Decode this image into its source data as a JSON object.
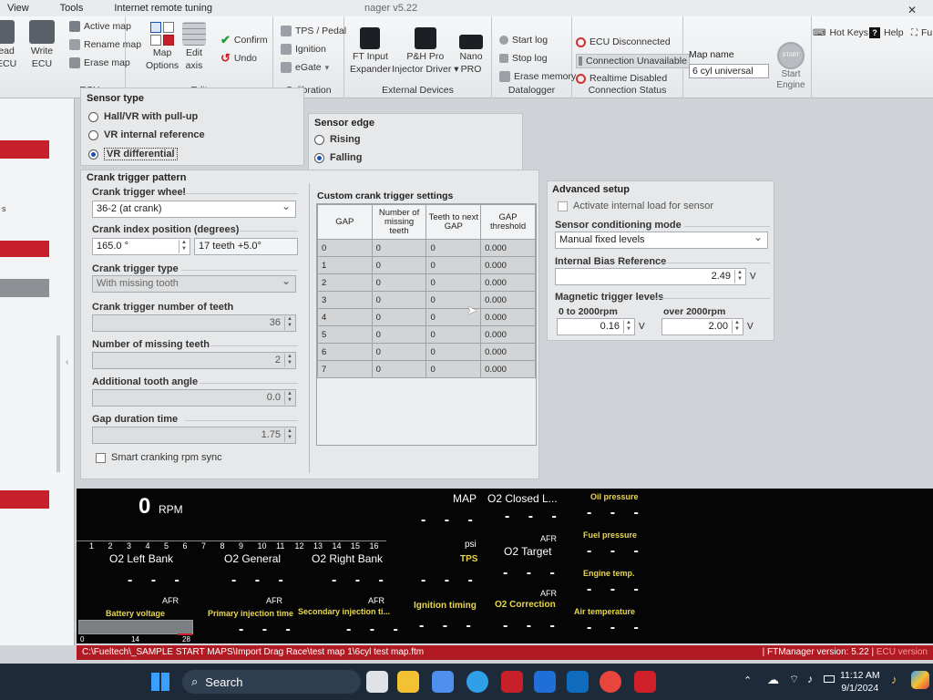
{
  "menu": [
    "View",
    "Tools",
    "Internet remote tuning"
  ],
  "window_title_partial": "nager v5.22",
  "ribbon": {
    "left_partial": {
      "read": "ead",
      "ecu": "ECU"
    },
    "write_ecu": [
      "Write",
      "ECU"
    ],
    "ecu_group_title": "ECU",
    "active_map": "Active map",
    "rename_map": "Rename map",
    "erase_map": "Erase map",
    "map_options": [
      "Map",
      "Options"
    ],
    "edit_axis": [
      "Edit",
      "axis"
    ],
    "confirm": "Confirm",
    "undo": "Undo",
    "edit_group_title": "Edit",
    "tps_pedal": "TPS / Pedal",
    "ignition": "Ignition",
    "egate": "eGate",
    "calibration_group_title": "Calibration",
    "ft_input_expander": [
      "FT Input",
      "Expander"
    ],
    "ph_pro_injector": [
      "P&H Pro",
      "Injector Driver ▾"
    ],
    "nano_pro": [
      "Nano",
      "PRO"
    ],
    "external_group_title": "External Devices",
    "start_log": "Start log",
    "stop_log": "Stop log",
    "erase_memory": "Erase memory",
    "datalogger_group_title": "Datalogger",
    "ecu_disconnected": "ECU Disconnected",
    "connection_unavailable": "Connection Unavailable",
    "realtime_disabled": "Realtime Disabled",
    "connection_group_title": "Connection Status",
    "map_name_label": "Map name",
    "map_name_value": "6 cyl universal",
    "start_engine": [
      "Start",
      "Engine"
    ],
    "start_engine_badge": "START",
    "hot_keys": "Hot Keys",
    "help": "Help",
    "fu_partial": "Fu"
  },
  "sensor_type": {
    "title": "Sensor type",
    "options": [
      "Hall/VR with pull-up",
      "VR internal reference",
      "VR differential"
    ],
    "selected_index": 2
  },
  "sensor_edge": {
    "title": "Sensor edge",
    "options": [
      "Rising",
      "Falling"
    ],
    "selected_index": 1
  },
  "crank": {
    "title": "Crank trigger pattern",
    "wheel_label": "Crank trigger wheel",
    "wheel_value": "36-2 (at crank)",
    "index_label": "Crank index position (degrees)",
    "index_value": "165.0 °",
    "index_teeth": "17 teeth +5.0°",
    "type_label": "Crank trigger type",
    "type_value": "With missing tooth",
    "teeth_label": "Crank trigger number of teeth",
    "teeth_value": "36",
    "missing_label": "Number of missing teeth",
    "missing_value": "2",
    "angle_label": "Additional tooth angle",
    "angle_value": "0.0",
    "gap_label": "Gap duration time",
    "gap_value": "1.75",
    "smart_label": "Smart cranking rpm sync"
  },
  "custom": {
    "title": "Custom crank trigger settings",
    "headers": [
      "GAP",
      "Number of missing teeth",
      "Teeth to next GAP",
      "GAP threshold"
    ],
    "rows": [
      [
        "0",
        "0",
        "0",
        "0.000"
      ],
      [
        "1",
        "0",
        "0",
        "0.000"
      ],
      [
        "2",
        "0",
        "0",
        "0.000"
      ],
      [
        "3",
        "0",
        "0",
        "0.000"
      ],
      [
        "4",
        "0",
        "0",
        "0.000"
      ],
      [
        "5",
        "0",
        "0",
        "0.000"
      ],
      [
        "6",
        "0",
        "0",
        "0.000"
      ],
      [
        "7",
        "0",
        "0",
        "0.000"
      ]
    ]
  },
  "advanced": {
    "title": "Advanced setup",
    "activate_label": "Activate internal load for sensor",
    "mode_label": "Sensor conditioning mode",
    "mode_value": "Manual fixed levels",
    "bias_label": "Internal Bias Reference",
    "bias_value": "2.49",
    "unit_v": "V",
    "mag_label": "Magnetic trigger levels",
    "low_label": "0 to 2000rpm",
    "low_value": "0.16",
    "high_label": "over 2000rpm",
    "high_value": "2.00"
  },
  "dashboard": {
    "rpm_value": "0",
    "rpm_unit": "RPM",
    "rpm_scale": [
      "1",
      "2",
      "3",
      "4",
      "5",
      "6",
      "7",
      "8",
      "9",
      "10",
      "11",
      "12",
      "13",
      "14",
      "15",
      "16"
    ],
    "o2_left": "O2 Left Bank",
    "o2_general": "O2 General",
    "o2_right": "O2 Right Bank",
    "map": "MAP",
    "o2_closed": "O2 Closed L...",
    "psi": "psi",
    "tps": "TPS",
    "afr": "AFR",
    "o2_target": "O2 Target",
    "ignition_timing": "Ignition timing",
    "o2_correction": "O2 Correction",
    "battery": "Battery voltage",
    "battery_scale": [
      "0",
      "14",
      "28"
    ],
    "primary_inj": "Primary injection time",
    "secondary_inj": "Secondary injection ti...",
    "oil_pressure": "Oil pressure",
    "fuel_pressure": "Fuel pressure",
    "engine_temp": "Engine temp.",
    "air_temp": "Air temperature",
    "no_value": "- - -"
  },
  "status": {
    "path": "C:\\Fueltech\\_SAMPLE START MAPS\\Import Drag Race\\test map 1\\6cyl test map.ftm",
    "version": "FTManager version: 5.22",
    "ecu_version_partial": "ECU version"
  },
  "taskbar": {
    "search": "Search",
    "time": "11:12 AM",
    "date": "9/1/2024"
  },
  "colors": {
    "accent_red": "#c8202b",
    "selected_blue": "#1a4fb5",
    "dash_yellow": "#e8d74a"
  }
}
